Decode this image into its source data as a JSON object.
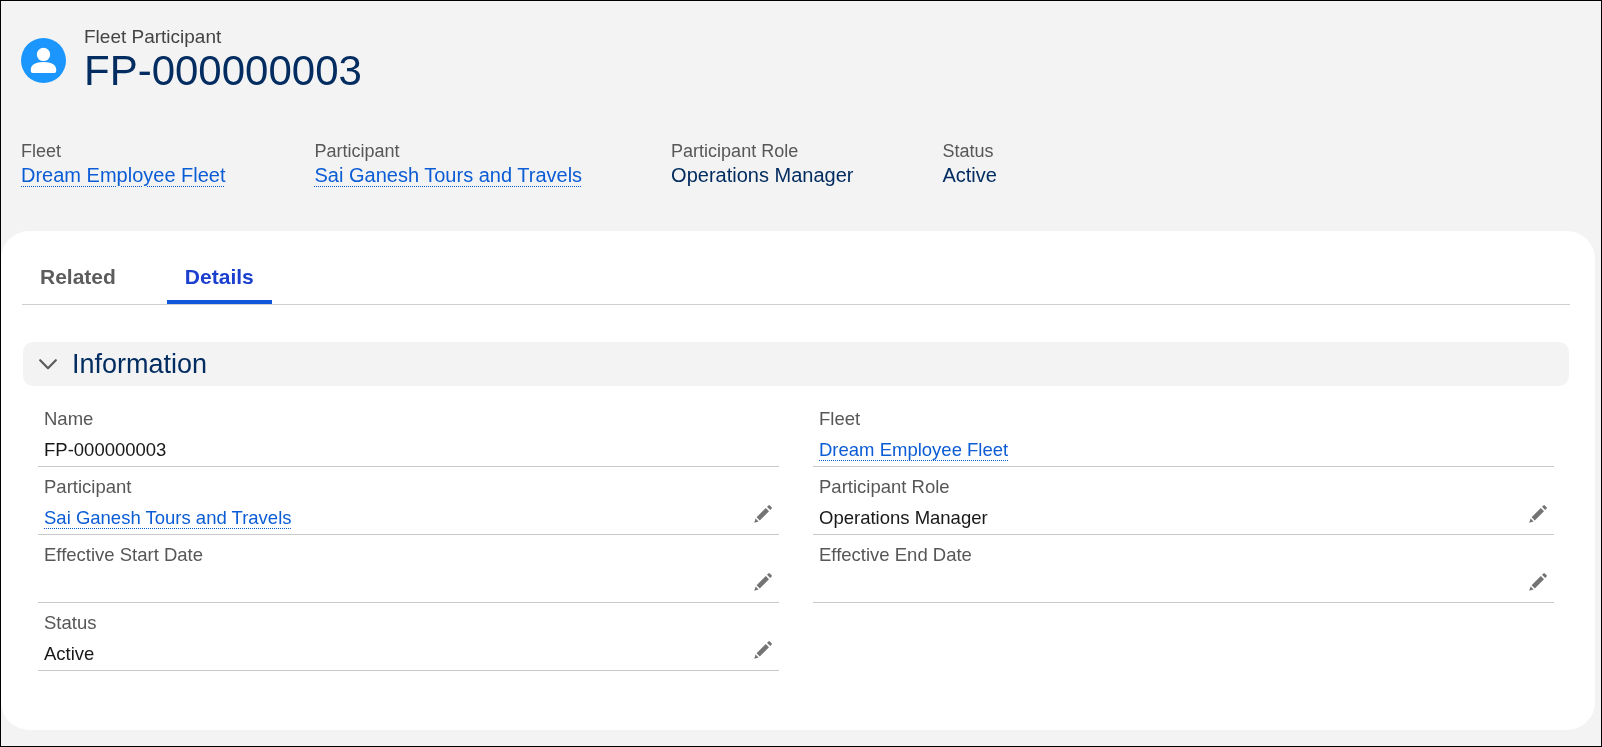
{
  "record": {
    "object_type": "Fleet Participant",
    "title": "FP-000000003"
  },
  "highlights": [
    {
      "label": "Fleet",
      "value": "Dream Employee Fleet",
      "kind": "link"
    },
    {
      "label": "Participant",
      "value": "Sai Ganesh Tours and Travels",
      "kind": "link"
    },
    {
      "label": "Participant Role",
      "value": "Operations Manager",
      "kind": "text"
    },
    {
      "label": "Status",
      "value": "Active",
      "kind": "text"
    }
  ],
  "tabs": [
    {
      "label": "Related",
      "selected": false
    },
    {
      "label": "Details",
      "selected": true
    }
  ],
  "section": {
    "title": "Information",
    "expanded": true,
    "fields": [
      {
        "label": "Name",
        "value": "FP-000000003",
        "kind": "text",
        "editable": false
      },
      {
        "label": "Fleet",
        "value": "Dream Employee Fleet",
        "kind": "link",
        "editable": false
      },
      {
        "label": "Participant",
        "value": "Sai Ganesh Tours and Travels",
        "kind": "link",
        "editable": true
      },
      {
        "label": "Participant Role",
        "value": "Operations Manager",
        "kind": "text",
        "editable": true
      },
      {
        "label": "Effective Start Date",
        "kind": "text",
        "editable": true
      },
      {
        "label": "Effective End Date",
        "kind": "text",
        "editable": true
      },
      {
        "label": "Status",
        "value": "Active",
        "kind": "text",
        "editable": true
      }
    ]
  }
}
